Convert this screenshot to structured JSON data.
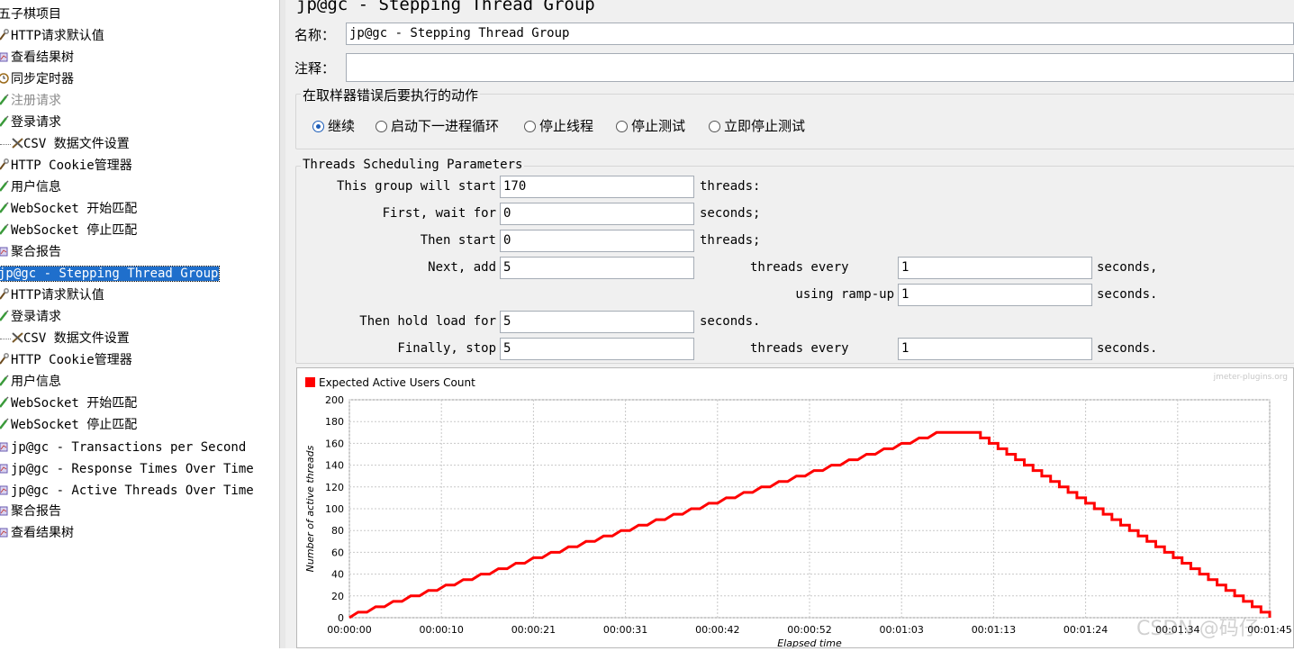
{
  "tree": {
    "items": [
      {
        "label": "五子棋项目",
        "icon": "folder-icon",
        "indent": 0,
        "state": "normal"
      },
      {
        "label": "HTTP请求默认值",
        "icon": "wrench-icon",
        "indent": 0,
        "state": "normal"
      },
      {
        "label": "查看结果树",
        "icon": "listener-icon",
        "indent": 0,
        "state": "normal"
      },
      {
        "label": "同步定时器",
        "icon": "timer-icon",
        "indent": 0,
        "state": "normal"
      },
      {
        "label": "注册请求",
        "icon": "sampler-icon",
        "indent": 0,
        "state": "disabled"
      },
      {
        "label": "登录请求",
        "icon": "sampler-icon",
        "indent": 0,
        "state": "normal"
      },
      {
        "label": "CSV 数据文件设置",
        "icon": "config-tools-icon",
        "indent": 1,
        "state": "normal"
      },
      {
        "label": "HTTP Cookie管理器",
        "icon": "wrench-icon",
        "indent": 0,
        "state": "normal"
      },
      {
        "label": "用户信息",
        "icon": "sampler-icon",
        "indent": 0,
        "state": "normal"
      },
      {
        "label": "WebSocket 开始匹配",
        "icon": "sampler-icon",
        "indent": 0,
        "state": "normal"
      },
      {
        "label": "WebSocket 停止匹配",
        "icon": "sampler-icon",
        "indent": 0,
        "state": "normal"
      },
      {
        "label": "聚合报告",
        "icon": "listener-icon",
        "indent": 0,
        "state": "normal"
      },
      {
        "label": "jp@gc - Stepping Thread Group",
        "icon": "",
        "indent": 0,
        "state": "selected"
      },
      {
        "label": "HTTP请求默认值",
        "icon": "wrench-icon",
        "indent": 0,
        "state": "normal"
      },
      {
        "label": "登录请求",
        "icon": "sampler-icon",
        "indent": 0,
        "state": "normal"
      },
      {
        "label": "CSV 数据文件设置",
        "icon": "config-tools-icon",
        "indent": 1,
        "state": "normal"
      },
      {
        "label": "HTTP Cookie管理器",
        "icon": "wrench-icon",
        "indent": 0,
        "state": "normal"
      },
      {
        "label": "用户信息",
        "icon": "sampler-icon",
        "indent": 0,
        "state": "normal"
      },
      {
        "label": "WebSocket 开始匹配",
        "icon": "sampler-icon",
        "indent": 0,
        "state": "normal"
      },
      {
        "label": "WebSocket 停止匹配",
        "icon": "sampler-icon",
        "indent": 0,
        "state": "normal"
      },
      {
        "label": "jp@gc - Transactions per Second",
        "icon": "listener-icon",
        "indent": 0,
        "state": "normal"
      },
      {
        "label": "jp@gc - Response Times Over Time",
        "icon": "listener-icon",
        "indent": 0,
        "state": "normal"
      },
      {
        "label": "jp@gc - Active Threads Over Time",
        "icon": "listener-icon",
        "indent": 0,
        "state": "normal"
      },
      {
        "label": "聚合报告",
        "icon": "listener-icon",
        "indent": 0,
        "state": "normal"
      },
      {
        "label": "查看结果树",
        "icon": "listener-icon",
        "indent": 0,
        "state": "normal"
      }
    ]
  },
  "panel": {
    "title": "jp@gc - Stepping Thread Group",
    "name_label": "名称：",
    "name_value": "jp@gc - Stepping Thread Group",
    "comment_label": "注释：",
    "comment_value": "",
    "error_group": {
      "title": "在取样器错误后要执行的动作",
      "options": [
        "继续",
        "启动下一进程循环",
        "停止线程",
        "停止测试",
        "立即停止测试"
      ],
      "selected": "继续"
    },
    "sched": {
      "title": "Threads Scheduling Parameters",
      "start_label": "This group will start",
      "start_value": "170",
      "start_unit": "threads:",
      "wait_label": "First, wait for",
      "wait_value": "0",
      "wait_unit": "seconds;",
      "then_label": "Then start",
      "then_value": "0",
      "then_unit": "threads;",
      "next_label": "Next, add",
      "next_value": "5",
      "next_mid": "threads every",
      "next_every_value": "1",
      "next_unit": "seconds,",
      "ramp_label": "using ramp-up",
      "ramp_value": "1",
      "ramp_unit": "seconds.",
      "hold_label": "Then hold load for",
      "hold_value": "5",
      "hold_unit": "seconds.",
      "stop_label": "Finally, stop",
      "stop_value": "5",
      "stop_mid": "threads every",
      "stop_every_value": "1",
      "stop_unit": "seconds."
    }
  },
  "chart_data": {
    "type": "line",
    "title": "",
    "brand": "jmeter-plugins.org",
    "legend": "Expected Active Users Count",
    "legend_position": "top-left",
    "xlabel": "Elapsed time",
    "ylabel": "Number of active threads",
    "ylim": [
      0,
      200
    ],
    "yticks": [
      0,
      20,
      40,
      60,
      80,
      100,
      120,
      140,
      160,
      180,
      200
    ],
    "xlim_seconds": [
      0,
      105
    ],
    "xticks": [
      "00:00:00",
      "00:00:10",
      "00:00:21",
      "00:00:31",
      "00:00:42",
      "00:00:52",
      "00:01:03",
      "00:01:13",
      "00:01:24",
      "00:01:34",
      "00:01:45"
    ],
    "grid": true,
    "series_color": "#ff0000",
    "series": [
      {
        "name": "Expected Active Users Count",
        "step_up": {
          "start_s": 0,
          "step_s": 2,
          "add": 5,
          "ramp_s": 1,
          "peak": 170
        },
        "hold_s": 5,
        "step_down": {
          "stop": 5,
          "every_s": 1
        }
      }
    ]
  },
  "watermark": "CSDN @码仔"
}
